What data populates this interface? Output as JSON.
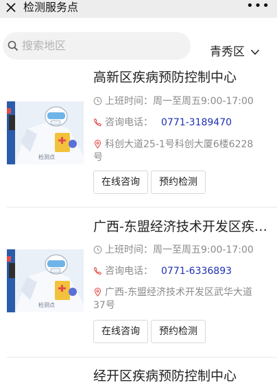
{
  "header": {
    "title": "检测服务点",
    "more": "•••"
  },
  "search": {
    "placeholder": "搜索地区"
  },
  "region": {
    "selected": "青秀区"
  },
  "labels": {
    "consult": "在线咨询",
    "book": "预约检测"
  },
  "thumb_caption": "检测点",
  "colors": {
    "phone": "#1d2fb3",
    "secondary_text": "#8a8a8a",
    "icon_red": "#e34b4b"
  },
  "centers": [
    {
      "name": "高新区疾病预防控制中心",
      "hours": "上班时间：周一至周五9:00-17:00",
      "phone_label": "咨询电话：",
      "phone": "0771-3189470",
      "address_line1": "科创大道25-1号科创大厦6楼6228",
      "address_line2": "号"
    },
    {
      "name": "广西-东盟经济技术开发区疾病预防控制中心",
      "hours": "上班时间：周一至周五9:00-17:00",
      "phone_label": "咨询电话：",
      "phone": "0771-6336893",
      "address_line1": "广西-东盟经济技术开发区武华大道",
      "address_line2": "37号"
    },
    {
      "name": "经开区疾病预防控制中心"
    }
  ]
}
